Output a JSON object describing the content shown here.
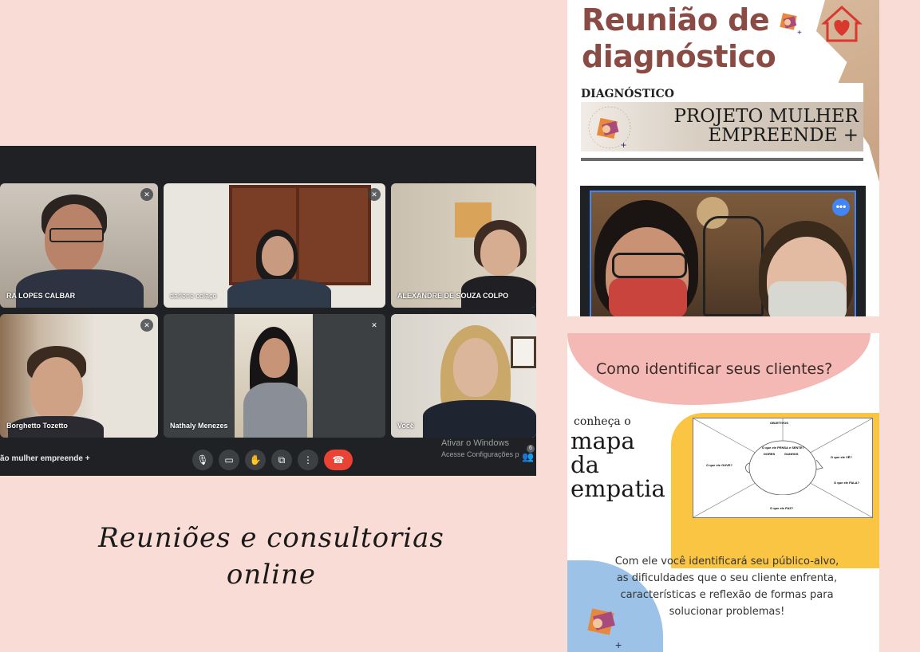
{
  "meet": {
    "participants": [
      {
        "name": "RA LOPES CALBAR",
        "muted": true
      },
      {
        "name": "darlene colaço",
        "muted": true
      },
      {
        "name": "ALEXANDRE DE SOUZA COLPO",
        "muted": false
      },
      {
        "name": "Borghetto Tozetto",
        "muted": true
      },
      {
        "name": "Nathaly Menezes",
        "muted": true
      },
      {
        "name": "Você",
        "muted": false
      }
    ],
    "meeting_name": "ão mulher empreende +",
    "activate_windows": {
      "line1": "Ativar o Windows",
      "line2": "Acesse Configurações p"
    },
    "participant_count": "6",
    "colors": {
      "end_call": "#ea4335",
      "active_border": "#8ab4f8"
    }
  },
  "caption": {
    "line1": "Reuniões e consultorias",
    "line2": "online"
  },
  "card_diagnostico": {
    "title_line1": "Reunião de",
    "title_line2": "diagnóstico",
    "label": "DIAGNÓSTICO",
    "project_line1": "PROJETO MULHER",
    "project_line2": "EMPREENDE +",
    "logo_arc_text": "MULHER EMPREENDE",
    "title_color": "#8b4b45"
  },
  "card_empatia": {
    "question": "Como identificar seus clientes?",
    "conheca": "conheça o",
    "mapa_line1": "mapa",
    "mapa_line2": "da",
    "mapa_line3": "empatia",
    "body_line1": "Com ele você identificará seu público-alvo,",
    "body_line2": "as dificuldades que o seu cliente enfrenta,",
    "body_line3": "características e reflexão de formas para",
    "body_line4": "solucionar problemas!",
    "map_labels": {
      "objetivos": "OBJETIVOS",
      "pensa_sente": "O que ele PENSA e SENTE?",
      "ouve": "O que ele OUVE?",
      "ve": "O que ele VÊ?",
      "fala": "O que ele FALA?",
      "faz": "O que ele FAZ?",
      "dores": "DORES",
      "ganhos": "GANHOS"
    }
  }
}
